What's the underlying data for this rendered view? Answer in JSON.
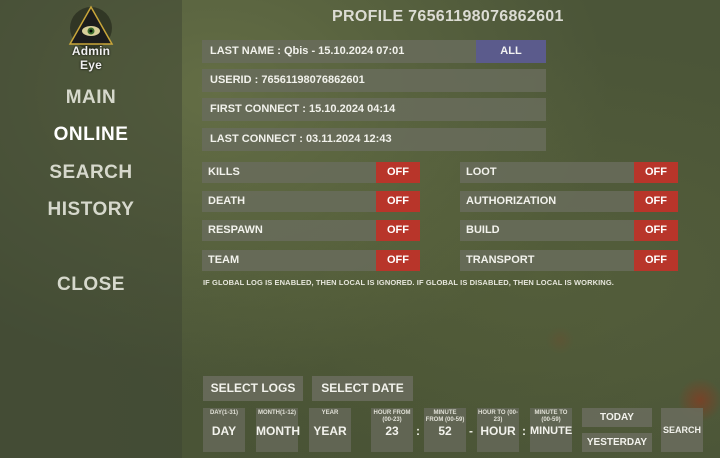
{
  "logo": {
    "text": "Admin Eye"
  },
  "nav": {
    "main": "MAIN",
    "online": "ONLINE",
    "search": "SEARCH",
    "history": "HISTORY",
    "close": "CLOSE"
  },
  "title": "PROFILE 76561198076862601",
  "info": {
    "last_name": "LAST NAME : Qbis - 15.10.2024 07:01",
    "all_button": "ALL",
    "userid": "USERID : 76561198076862601",
    "first_connect": "FIRST CONNECT : 15.10.2024 04:14",
    "last_connect": "LAST CONNECT : 03.11.2024 12:43"
  },
  "toggles": {
    "left": [
      {
        "label": "KILLS",
        "state": "OFF"
      },
      {
        "label": "DEATH",
        "state": "OFF"
      },
      {
        "label": "RESPAWN",
        "state": "OFF"
      },
      {
        "label": "TEAM",
        "state": "OFF"
      }
    ],
    "right": [
      {
        "label": "LOOT",
        "state": "OFF"
      },
      {
        "label": "AUTHORIZATION",
        "state": "OFF"
      },
      {
        "label": "BUILD",
        "state": "OFF"
      },
      {
        "label": "TRANSPORT",
        "state": "OFF"
      }
    ]
  },
  "note": "IF GLOBAL LOG IS ENABLED, THEN LOCAL IS IGNORED. IF GLOBAL IS DISABLED, THEN LOCAL IS WORKING.",
  "actions": {
    "select_logs": "SELECT LOGS",
    "select_date": "SELECT DATE"
  },
  "date_fields": {
    "day": {
      "label": "DAY(1-31)",
      "value": "DAY"
    },
    "month": {
      "label": "MONTH(1-12)",
      "value": "MONTH"
    },
    "year": {
      "label": "YEAR",
      "value": "YEAR"
    },
    "hour_from": {
      "label": "HOUR FROM (00-23)",
      "value": "23"
    },
    "minute_from": {
      "label": "MINUTE FROM (00-59)",
      "value": "52"
    },
    "hour_to": {
      "label": "HOUR TO (00-23)",
      "value": "HOUR"
    },
    "minute_to": {
      "label": "MINUTE TO (00-59)",
      "value": "MINUTE"
    }
  },
  "separators": {
    "colon": ":",
    "dash": "-"
  },
  "quick": {
    "today": "TODAY",
    "yesterday": "YESTERDAY",
    "search": "SEARCH"
  },
  "colors": {
    "off": "#b8352a",
    "all": "#5b5b8c",
    "panel": "#696c5c"
  },
  "icons": {
    "logo": "eye-triangle-icon"
  }
}
